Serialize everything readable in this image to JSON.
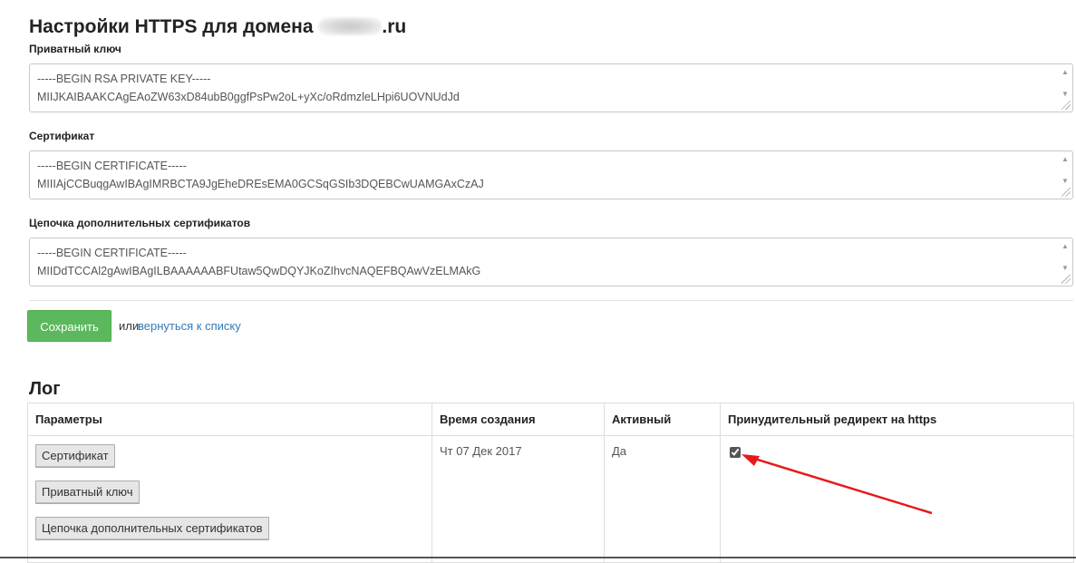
{
  "page_title": "Настройки HTTPS для домена",
  "page_title_suffix": ".ru",
  "private_key": {
    "label": "Приватный ключ",
    "value": "-----BEGIN RSA PRIVATE KEY-----\nMIIJKAIBAAKCAgEAoZW63xD84ubB0ggfPsPw2oL+yXc/oRdmzleLHpi6UOVNUdJd"
  },
  "certificate": {
    "label": "Сертификат",
    "value": "-----BEGIN CERTIFICATE-----\nMIIIAjCCBuqgAwIBAgIMRBCTA9JgEheDREsEMA0GCSqGSIb3DQEBCwUAMGAxCzAJ"
  },
  "chain": {
    "label": "Цепочка дополнительных сертификатов",
    "value": "-----BEGIN CERTIFICATE-----\nMIIDdTCCAl2gAwIBAgILBAAAAAABFUtaw5QwDQYJKoZIhvcNAQEFBQAwVzELMAkG"
  },
  "actions": {
    "save_label": "Сохранить",
    "or_text": "или",
    "back_link": "вернуться к списку"
  },
  "log": {
    "title": "Лог",
    "columns": [
      "Параметры",
      "Время создания",
      "Активный",
      "Принудительный редирект на https"
    ],
    "rows": [
      {
        "buttons": [
          "Сертификат",
          "Приватный ключ",
          "Цепочка дополнительных сертификатов"
        ],
        "created": "Чт 07 Дек 2017",
        "active": "Да",
        "force_redirect": true
      }
    ]
  },
  "annotation": {
    "arrow_color": "#e8191c"
  }
}
